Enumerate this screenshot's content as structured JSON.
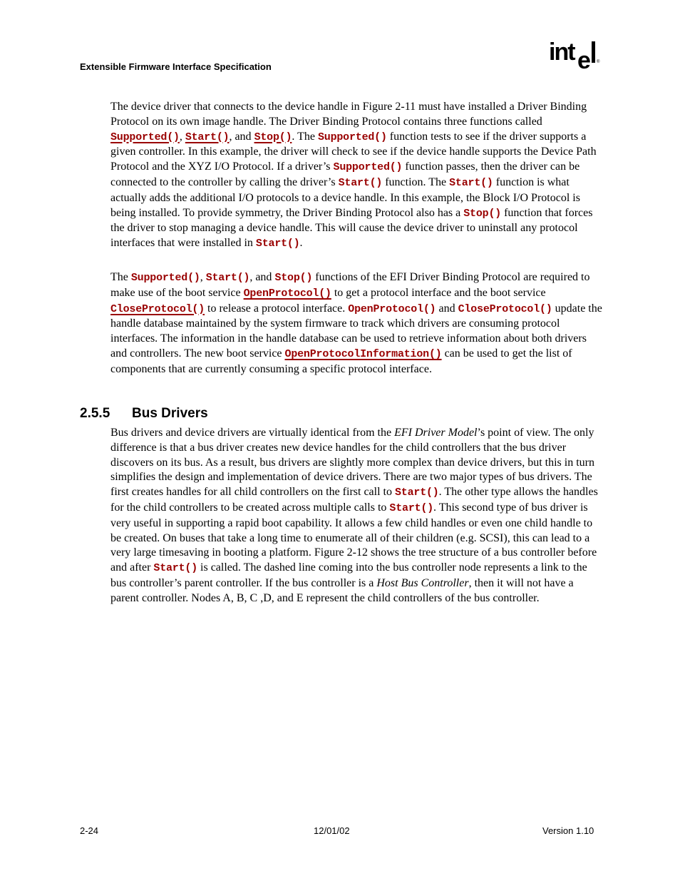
{
  "header": {
    "title": "Extensible Firmware Interface Specification",
    "logo_text": "intel",
    "logo_registered": "®"
  },
  "paragraph1": {
    "t1": "The device driver that connects to the device handle in Figure 2-11 must have installed a Driver Binding Protocol on its own image handle.  The Driver Binding Protocol contains three functions called ",
    "c1": "Supported()",
    "t2": ", ",
    "c2": "Start()",
    "t3": ", and ",
    "c3": "Stop()",
    "t4": ".  The ",
    "c4": "Supported()",
    "t5": " function tests to see if the driver supports a given controller.  In this example, the driver will check to see if the device handle supports the Device Path Protocol and the XYZ I/O Protocol.  If a driver’s ",
    "c5": "Supported()",
    "t6": " function passes, then the driver can be connected to the controller by calling the driver’s ",
    "c6": "Start()",
    "t7": " function.  The ",
    "c7": "Start()",
    "t8": " function is what actually adds the additional I/O protocols to a device handle.  In this example, the Block I/O Protocol is being installed.  To provide symmetry, the Driver Binding Protocol also has a ",
    "c8": "Stop()",
    "t9": " function that forces the driver to stop managing a device handle.  This will cause the device driver to uninstall any protocol interfaces that were installed in ",
    "c9": "Start()",
    "t10": "."
  },
  "paragraph2": {
    "t1": "The ",
    "c1": "Supported()",
    "t2": ", ",
    "c2": "Start()",
    "t3": ", and ",
    "c3": "Stop()",
    "t4": " functions of the EFI Driver Binding Protocol are required to make use of the boot service ",
    "c4": "OpenProtocol()",
    "t5": " to get a protocol interface and the boot service ",
    "c5": "CloseProtocol()",
    "t6": " to release a protocol interface.  ",
    "c6": "OpenProtocol()",
    "t7": " and ",
    "c7": "CloseProtocol()",
    "t8": " update the handle database maintained by the system firmware to track which drivers are consuming protocol interfaces.  The information in the handle database can be used to retrieve information about both drivers and controllers.  The new boot service ",
    "c8": "OpenProtocolInformation()",
    "t9": " can be used to get the list of components that are currently consuming a specific protocol interface."
  },
  "section": {
    "number": "2.5.5",
    "title": "Bus Drivers"
  },
  "paragraph3": {
    "t1": "Bus drivers and device drivers are virtually identical from the ",
    "i1": "EFI Driver Model",
    "t2": "’s point of view.  The only difference is that a bus driver creates new device handles for the child controllers that the bus driver discovers on its bus.  As a result, bus drivers are slightly more complex than device drivers, but this in turn simplifies the design and implementation of device drivers.  There are two major types of bus drivers.  The first creates handles for all child controllers on the first call to ",
    "c1": "Start()",
    "t3": ".  The other type allows the handles for the child controllers to be created across multiple calls to ",
    "c2": "Start()",
    "t4": ".  This second type of bus driver is very useful in supporting a rapid boot capability.  It allows a few child handles or even one child handle to be created.  On buses that take a long time to enumerate all of their children (e.g. SCSI), this can lead to a very large timesaving in booting a platform.  Figure 2-12 shows the tree structure of a bus controller before and after ",
    "c3": "Start()",
    "t5": " is called.  The dashed line coming into the bus controller node represents a link to the bus controller’s parent controller.  If the bus controller is a ",
    "i2": "Host Bus Controller",
    "t6": ", then it will not have a parent controller.  Nodes A, B, C ,D, and E represent the child controllers of the bus controller."
  },
  "footer": {
    "page": "2-24",
    "date": "12/01/02",
    "version": "Version 1.10"
  },
  "colors": {
    "code": "#990000",
    "text": "#000000"
  }
}
